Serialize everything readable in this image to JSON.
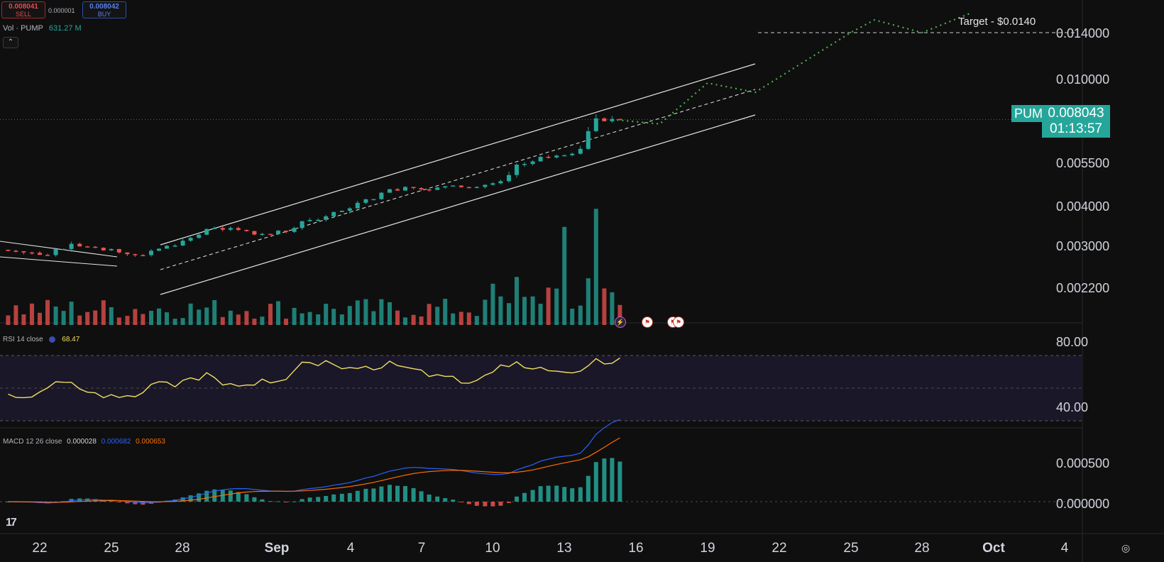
{
  "trade": {
    "sell_price": "0.008041",
    "sell_label": "SELL",
    "spread": "0.000001",
    "buy_price": "0.008042",
    "buy_label": "BUY"
  },
  "volume": {
    "label": "Vol · PUMP",
    "value": "631.27 M"
  },
  "collapse_icon": "chevron-up-icon",
  "price_axis": {
    "labels": [
      "0.014000",
      "0.010000",
      "0.005500",
      "0.004000",
      "0.003000",
      "0.002200"
    ]
  },
  "last_price": {
    "symbol": "PUMPUSD",
    "price": "0.008043",
    "countdown": "01:13:57"
  },
  "target_label": "Target - $0.0140",
  "rsi": {
    "name": "RSI",
    "params": "14 close",
    "value": "68.47",
    "axis": [
      "80.00",
      "40.00"
    ]
  },
  "macd": {
    "name": "MACD",
    "params": "12 26 close",
    "hist": "0.000028",
    "macd": "0.000682",
    "signal": "0.000653",
    "axis": [
      "0.000500",
      "0.000000"
    ]
  },
  "time_axis": [
    "22",
    "25",
    "28",
    "Sep",
    "4",
    "7",
    "10",
    "13",
    "16",
    "19",
    "22",
    "25",
    "28",
    "Oct",
    "4"
  ],
  "colors": {
    "up": "#26a69a",
    "down": "#ef5350",
    "rsi": "#f0e060",
    "macd": "#2962ff",
    "signal": "#ff6d00",
    "projection": "#4caf50",
    "bg": "#0f0f0f"
  },
  "events": [
    "lightning-icon",
    "us-flag-icon",
    "us-flag-icon"
  ],
  "chart_data": {
    "type": "candlestick",
    "symbol": "PUMPUSD",
    "x_range": [
      "Aug 21",
      "Oct 5"
    ],
    "ylim": [
      0.0022,
      0.014
    ],
    "ohlc_daily": [
      {
        "date": "Aug 21",
        "o": 0.003,
        "h": 0.00315,
        "l": 0.00285,
        "c": 0.00295
      },
      {
        "date": "Aug 22",
        "o": 0.00295,
        "h": 0.0031,
        "l": 0.0028,
        "c": 0.0029
      },
      {
        "date": "Aug 23",
        "o": 0.0029,
        "h": 0.00325,
        "l": 0.00285,
        "c": 0.00315
      },
      {
        "date": "Aug 24",
        "o": 0.00315,
        "h": 0.0032,
        "l": 0.003,
        "c": 0.00305
      },
      {
        "date": "Aug 25",
        "o": 0.00305,
        "h": 0.0031,
        "l": 0.0029,
        "c": 0.00295
      },
      {
        "date": "Aug 26",
        "o": 0.00295,
        "h": 0.003,
        "l": 0.00275,
        "c": 0.0029
      },
      {
        "date": "Aug 27",
        "o": 0.0029,
        "h": 0.00315,
        "l": 0.00285,
        "c": 0.0031
      },
      {
        "date": "Aug 28",
        "o": 0.0031,
        "h": 0.00335,
        "l": 0.003,
        "c": 0.0033
      },
      {
        "date": "Aug 29",
        "o": 0.0033,
        "h": 0.0036,
        "l": 0.00325,
        "c": 0.00355
      },
      {
        "date": "Aug 30",
        "o": 0.00355,
        "h": 0.00375,
        "l": 0.00345,
        "c": 0.0035
      },
      {
        "date": "Aug 31",
        "o": 0.0035,
        "h": 0.0036,
        "l": 0.00335,
        "c": 0.0034
      },
      {
        "date": "Sep 1",
        "o": 0.0034,
        "h": 0.00355,
        "l": 0.0033,
        "c": 0.00345
      },
      {
        "date": "Sep 2",
        "o": 0.00345,
        "h": 0.0038,
        "l": 0.0034,
        "c": 0.00375
      },
      {
        "date": "Sep 3",
        "o": 0.00375,
        "h": 0.004,
        "l": 0.00365,
        "c": 0.00395
      },
      {
        "date": "Sep 4",
        "o": 0.00395,
        "h": 0.0044,
        "l": 0.00385,
        "c": 0.00425
      },
      {
        "date": "Sep 5",
        "o": 0.00425,
        "h": 0.0048,
        "l": 0.00415,
        "c": 0.0046
      },
      {
        "date": "Sep 6",
        "o": 0.0046,
        "h": 0.0049,
        "l": 0.00445,
        "c": 0.0048
      },
      {
        "date": "Sep 7",
        "o": 0.0048,
        "h": 0.005,
        "l": 0.00455,
        "c": 0.0047
      },
      {
        "date": "Sep 8",
        "o": 0.0047,
        "h": 0.00495,
        "l": 0.0046,
        "c": 0.00485
      },
      {
        "date": "Sep 9",
        "o": 0.00485,
        "h": 0.005,
        "l": 0.0047,
        "c": 0.0048
      },
      {
        "date": "Sep 10",
        "o": 0.0048,
        "h": 0.0051,
        "l": 0.0047,
        "c": 0.005
      },
      {
        "date": "Sep 11",
        "o": 0.005,
        "h": 0.0058,
        "l": 0.00495,
        "c": 0.00565
      },
      {
        "date": "Sep 12",
        "o": 0.00565,
        "h": 0.0062,
        "l": 0.0055,
        "c": 0.006
      },
      {
        "date": "Sep 13",
        "o": 0.006,
        "h": 0.0064,
        "l": 0.0059,
        "c": 0.0062
      },
      {
        "date": "Sep 14",
        "o": 0.0062,
        "h": 0.0084,
        "l": 0.00615,
        "c": 0.0081
      },
      {
        "date": "Sep 15",
        "o": 0.0081,
        "h": 0.0088,
        "l": 0.0077,
        "c": 0.00804
      }
    ],
    "channel": {
      "type": "ascending",
      "start": "Aug 27",
      "end": "Sep 21"
    },
    "projection": [
      {
        "date": "Sep 15",
        "value": 0.00804
      },
      {
        "date": "Sep 17",
        "value": 0.0078
      },
      {
        "date": "Sep 19",
        "value": 0.01
      },
      {
        "date": "Sep 21",
        "value": 0.0095
      },
      {
        "date": "Sep 25",
        "value": 0.014
      },
      {
        "date": "Sep 26",
        "value": 0.015
      },
      {
        "date": "Sep 28",
        "value": 0.014
      },
      {
        "date": "Sep 30",
        "value": 0.0155
      }
    ],
    "target": 0.014,
    "rsi_last": 68.47,
    "macd_last": {
      "macd": 0.000682,
      "signal": 0.000653,
      "hist": 2.8e-05
    }
  }
}
